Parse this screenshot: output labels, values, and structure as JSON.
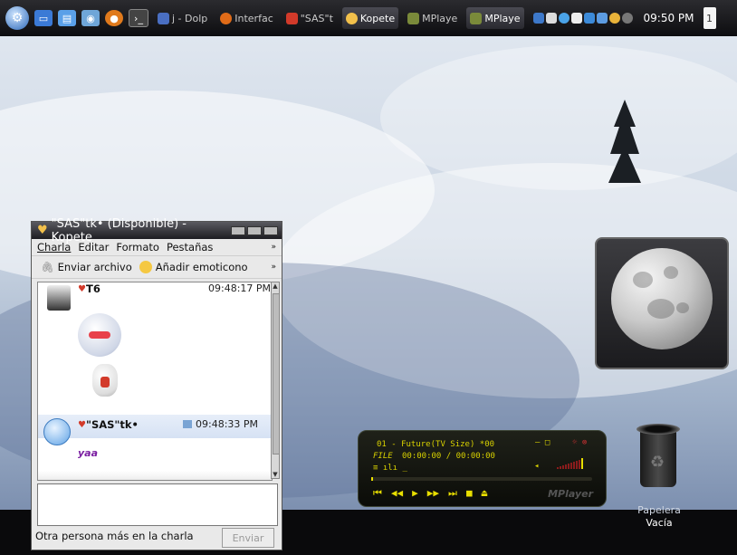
{
  "taskbar": {
    "tasks": [
      {
        "label": "j - Dolp",
        "color": "#4a6fc2"
      },
      {
        "label": "Interfac",
        "color": "#e06b18"
      },
      {
        "label": "\"SAS\"t",
        "color": "#d23a2a"
      },
      {
        "label": "Kopete",
        "color": "#f2c04b"
      },
      {
        "label": "MPlaye",
        "color": "#7a8a3a"
      },
      {
        "label": "MPlaye",
        "color": "#7a8a3a"
      }
    ],
    "clock": "09:50 PM",
    "pager": "1"
  },
  "kopete": {
    "title": "\"SAS\"tk• (Disponible) - Kopete",
    "menu": [
      "Charla",
      "Editar",
      "Formato",
      "Pestañas"
    ],
    "menu_more": "»",
    "toolbar": {
      "send_file": "Enviar archivo",
      "add_emoticon": "Añadir emoticono",
      "more": "»"
    },
    "messages": [
      {
        "sender": "T6",
        "time": "09:48:17 PM"
      },
      {
        "sender": "\"SAS\"tk•",
        "time": "09:48:33 PM",
        "text": "yaa"
      }
    ],
    "status": "Otra persona más en la charla",
    "send_button": "Enviar"
  },
  "mplayer": {
    "track": "01 - Future(TV Size)  *00",
    "file_label": "FILE",
    "time": "00:00:00 / 00:00:00",
    "logo": "MPlayer"
  },
  "trash": {
    "label_line1": "Papelera",
    "label_line2": "Vacía"
  },
  "colors": {
    "mplayer_accent": "#e8de00",
    "kopete_title_bg": "#2b2b30",
    "message_accent": "#7b1fa2"
  }
}
